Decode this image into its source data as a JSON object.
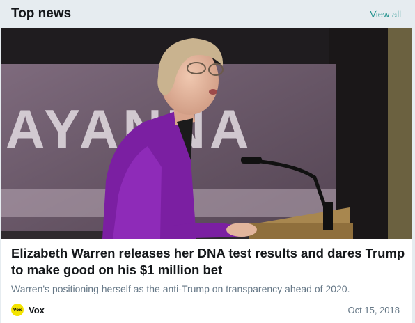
{
  "header": {
    "title": "Top news",
    "view_all_label": "View all"
  },
  "story": {
    "headline": "Elizabeth Warren releases her DNA test results and dares Trump to make good on his $1 million bet",
    "summary": "Warren's positioning herself as the anti-Trump on transparency ahead of 2020.",
    "source": {
      "name": "Vox",
      "logo_text": "Vox",
      "logo_color": "#f4e400"
    },
    "date": "Oct 15, 2018",
    "photo": {
      "banner_text": "AYANNA",
      "jacket_color": "#7b1fa2"
    }
  },
  "colors": {
    "background": "#e6ecf0",
    "link": "#1a8f8a",
    "text_primary": "#14171a",
    "text_secondary": "#657786"
  }
}
